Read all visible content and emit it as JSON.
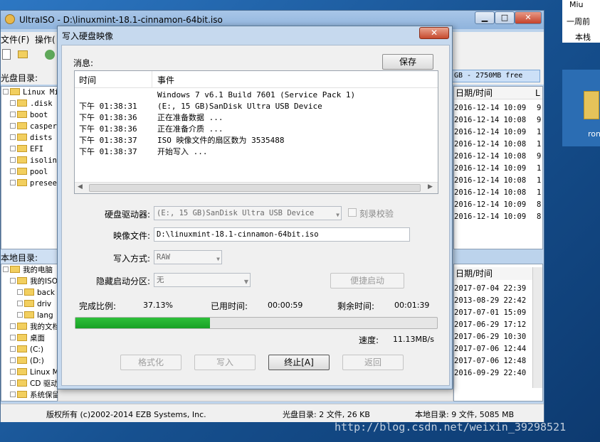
{
  "desktop": {
    "watermark": "http://blog.csdn.net/weixin_39298521",
    "right_items": [
      "Miu",
      "一周前",
      "本栈",
      "ron"
    ]
  },
  "main": {
    "title": "UltraISO - D:\\linuxmint-18.1-cinnamon-64bit.iso",
    "menu": [
      "文件(F)",
      "操作("
    ],
    "disc_dir_label": "光盘目录:",
    "disc_info": "GB - 2750MB free",
    "tree": [
      {
        "label": "Linux Mint",
        "level": 0
      },
      {
        "label": ".disk",
        "level": 1
      },
      {
        "label": "boot",
        "level": 1
      },
      {
        "label": "casper",
        "level": 1
      },
      {
        "label": "dists",
        "level": 1
      },
      {
        "label": "EFI",
        "level": 1
      },
      {
        "label": "isolinu",
        "level": 1
      },
      {
        "label": "pool",
        "level": 1
      },
      {
        "label": "preseed",
        "level": 1
      }
    ],
    "right_list": {
      "header_date": "日期/时间",
      "header_l": "L",
      "rows": [
        {
          "date": "2016-12-14 10:09",
          "l": "9"
        },
        {
          "date": "2016-12-14 10:08",
          "l": "9"
        },
        {
          "date": "2016-12-14 10:09",
          "l": "1"
        },
        {
          "date": "2016-12-14 10:08",
          "l": "1"
        },
        {
          "date": "2016-12-14 10:08",
          "l": "9"
        },
        {
          "date": "2016-12-14 10:09",
          "l": "1"
        },
        {
          "date": "2016-12-14 10:08",
          "l": "1"
        },
        {
          "date": "2016-12-14 10:08",
          "l": "1"
        },
        {
          "date": "2016-12-14 10:09",
          "l": "8"
        },
        {
          "date": "2016-12-14 10:09",
          "l": "8"
        }
      ]
    },
    "local_dir_label": "本地目录:",
    "local_tree": [
      {
        "label": "我的电脑",
        "level": 0
      },
      {
        "label": "我的ISO",
        "level": 1
      },
      {
        "label": "back",
        "level": 2
      },
      {
        "label": "driv",
        "level": 2
      },
      {
        "label": "lang",
        "level": 2
      },
      {
        "label": "我的文档",
        "level": 1
      },
      {
        "label": "桌面",
        "level": 1
      },
      {
        "label": "(C:)",
        "level": 1
      },
      {
        "label": "(D:)",
        "level": 1
      },
      {
        "label": "Linux M",
        "level": 1
      },
      {
        "label": "CD 驱动",
        "level": 1
      },
      {
        "label": "系统保留(G:)",
        "level": 1
      }
    ],
    "local_list": {
      "header_date": "日期/时间",
      "rows": [
        "2017-07-04 22:39",
        "2013-08-29 22:42",
        "2017-07-01 15:09",
        "2017-06-29 17:12",
        "2017-06-29 10:30",
        "2017-07-06 12:44",
        "2017-07-06 12:48",
        "2016-09-29 22:40"
      ]
    },
    "status": {
      "copyright": "版权所有 (c)2002-2014 EZB Systems, Inc.",
      "disc_summary": "光盘目录: 2 文件, 26 KB",
      "local_summary": "本地目录: 9 文件, 5085 MB"
    }
  },
  "dialog": {
    "title": "写入硬盘映像",
    "close": "✕",
    "messages_label": "消息:",
    "save_button": "保存",
    "log_headers": {
      "time": "时间",
      "event": "事件"
    },
    "log": [
      {
        "time": "",
        "event": "Windows 7 v6.1 Build 7601 (Service Pack 1)"
      },
      {
        "time": "下午 01:38:31",
        "event": "(E:, 15 GB)SanDisk Ultra USB Device"
      },
      {
        "time": "下午 01:38:36",
        "event": "正在准备数据 ..."
      },
      {
        "time": "下午 01:38:36",
        "event": "正在准备介质 ..."
      },
      {
        "time": "下午 01:38:37",
        "event": "ISO 映像文件的扇区数为 3535488"
      },
      {
        "time": "下午 01:38:37",
        "event": "开始写入 ..."
      }
    ],
    "drive_label": "硬盘驱动器:",
    "drive_value": "(E:, 15 GB)SanDisk Ultra USB Device",
    "verify_label": "刻录校验",
    "image_label": "映像文件:",
    "image_value": "D:\\linuxmint-18.1-cinnamon-64bit.iso",
    "method_label": "写入方式:",
    "method_value": "RAW",
    "hidden_label": "隐藏启动分区:",
    "hidden_value": "无",
    "quick_boot_button": "便捷启动",
    "progress_label": "完成比例:",
    "progress_value": "37.13%",
    "progress_fraction": 0.3713,
    "elapsed_label": "已用时间:",
    "elapsed_value": "00:00:59",
    "remaining_label": "剩余时间:",
    "remaining_value": "00:01:39",
    "speed_label": "速度:",
    "speed_value": "11.13MB/s",
    "buttons": {
      "format": "格式化",
      "write": "写入",
      "abort": "终止[A]",
      "back": "返回"
    },
    "colors": {
      "progress": "#2ec03a"
    }
  }
}
